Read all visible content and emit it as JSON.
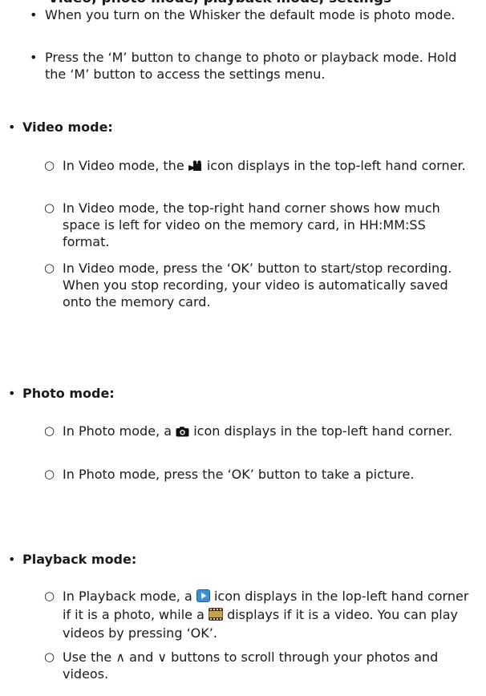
{
  "intro": {
    "cut_heading": "Video, photo mode, playback mode, settings",
    "bullets": [
      "When you turn on the Whisker the default mode is photo mode.",
      "Press the ‘M’ button to change to photo or playback mode. Hold the ‘M’ button to access the settings menu."
    ]
  },
  "sections": [
    {
      "title": "Video mode:",
      "items": [
        {
          "before": "In Video mode, the ",
          "icon": "video-camera-icon",
          "after": " icon displays in the top-left hand corner."
        },
        {
          "text": "In Video mode, the top-right hand corner shows how much space is left for video on the memory card, in HH:MM:SS format."
        },
        {
          "text": "In Video mode, press the ‘OK’ button to start/stop recording. When you stop recording, your video is automatically saved onto the memory card."
        }
      ]
    },
    {
      "title": "Photo mode:",
      "items": [
        {
          "before": "In Photo mode, a ",
          "icon": "camera-icon",
          "after": " icon displays in the top-left hand corner."
        },
        {
          "text": "In Photo mode, press the ‘OK’ button to take a picture."
        }
      ]
    },
    {
      "title": "Playback mode:",
      "items": [
        {
          "before": "In Playback mode, a ",
          "icon": "play-icon",
          "middle": " icon displays in the lop-left hand corner if it is a photo, while a ",
          "icon2": "film-icon",
          "after": " displays if it is a video. You can play videos by pressing ‘OK’."
        },
        {
          "before": "Use the ",
          "sym1": "∧",
          "middle": " and ",
          "sym2": "∨",
          "after": " buttons to scroll through your photos and videos."
        }
      ]
    }
  ],
  "bullet_glyphs": {
    "filled": "•",
    "hollow": "○"
  },
  "colors": {
    "text": "#1a1a1a",
    "play_icon": "#3c8fd8",
    "film_icon": "#c8a050"
  }
}
